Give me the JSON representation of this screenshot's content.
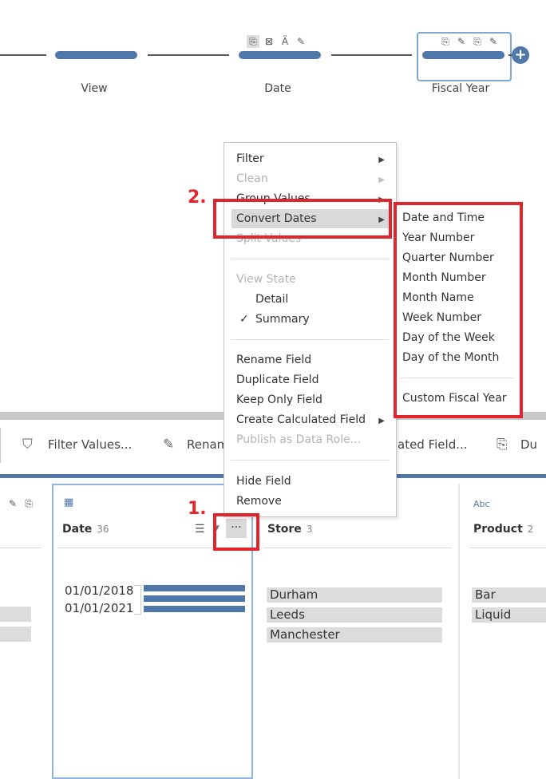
{
  "flow": {
    "steps": [
      {
        "label": "View"
      },
      {
        "label": "Date"
      },
      {
        "label": "Fiscal Year"
      }
    ],
    "add_button": "+"
  },
  "toolbar": {
    "items": [
      {
        "label": "Filter Values..."
      },
      {
        "label": "Renam"
      },
      {
        "label": "ated Field..."
      },
      {
        "label": "Du"
      }
    ]
  },
  "cards": {
    "date": {
      "type_icon": "calendar-icon",
      "title": "Date",
      "count": "36",
      "values": [
        "01/01/2018",
        "01/01/2021"
      ]
    },
    "store": {
      "title": "Store",
      "count": "3",
      "values": [
        "Durham",
        "Leeds",
        "Manchester"
      ]
    },
    "product": {
      "type_icon": "Abc",
      "title": "Product",
      "count": "2",
      "values": [
        "Bar",
        "Liquid"
      ]
    }
  },
  "context_menu": {
    "items": [
      {
        "label": "Filter",
        "disabled": false,
        "submenu": true
      },
      {
        "label": "Clean",
        "disabled": true,
        "submenu": true
      },
      {
        "label": "Group Values",
        "disabled": false,
        "submenu": true
      },
      {
        "label": "Convert Dates",
        "disabled": false,
        "submenu": true,
        "highlighted": true
      },
      {
        "label": "Split Values",
        "disabled": true,
        "submenu": true
      }
    ],
    "view_state": {
      "header": "View State",
      "detail": "Detail",
      "summary": "Summary",
      "check": "✓"
    },
    "field_actions": [
      "Rename Field",
      "Duplicate Field",
      "Keep Only Field",
      "Create Calculated Field",
      "Publish as Data Role..."
    ],
    "bottom": [
      "Hide Field",
      "Remove"
    ]
  },
  "submenu": {
    "items": [
      "Date and Time",
      "Year Number",
      "Quarter Number",
      "Month Number",
      "Month Name",
      "Week Number",
      "Day of the Week",
      "Day of the Month"
    ],
    "custom": "Custom Fiscal Year"
  },
  "annotations": {
    "step1": "1.",
    "step2": "2."
  },
  "colors": {
    "accent": "#4f77aa",
    "annotation": "#e1252c",
    "highlight": "#d9d9d9"
  }
}
